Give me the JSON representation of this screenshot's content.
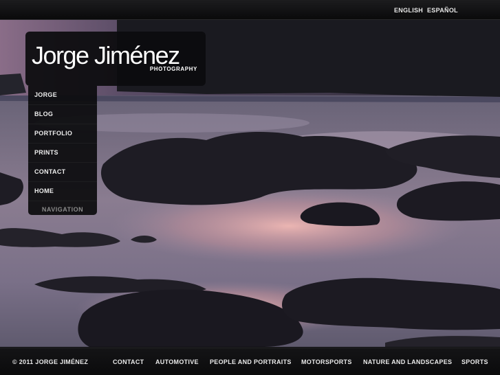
{
  "header": {
    "languages": [
      "ENGLISH",
      "ESPAÑOL"
    ]
  },
  "logo": {
    "name": "Jorge Jiménez",
    "subtitle": "PHOTOGRAPHY"
  },
  "nav": {
    "items": [
      "JORGE",
      "BLOG",
      "PORTFOLIO",
      "PRINTS",
      "CONTACT",
      "HOME"
    ],
    "caption": "NAVIGATION"
  },
  "footer": {
    "copyright": "© 2011 JORGE JIMÉNEZ",
    "links": [
      "CONTACT",
      "AUTOMOTIVE",
      "PEOPLE AND PORTRAITS",
      "MOTORSPORTS",
      "NATURE AND LANDSCAPES",
      "SPORTS"
    ]
  },
  "hero": {
    "description_icon": "seascape-photo",
    "colors": {
      "sky": "#6b5a78",
      "water_glow": "#e0a8a8",
      "rocks": "#1c1a22"
    }
  }
}
